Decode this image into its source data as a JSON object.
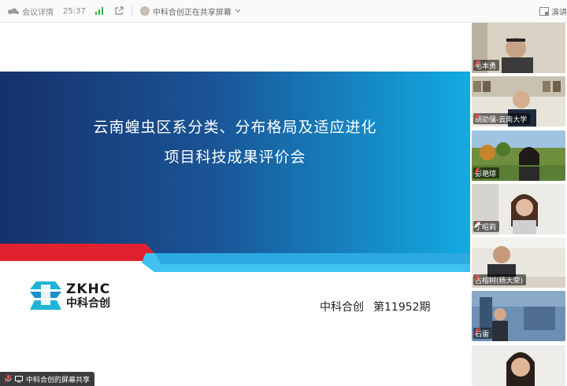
{
  "topbar": {
    "meeting_details": "会议详情",
    "elapsed": "25:37",
    "presenter_status": "中科合创正在共享屏幕",
    "right_label": "演讲"
  },
  "slide": {
    "title_line1": "云南蝗虫区系分类、分布格局及适应进化",
    "title_line2": "项目科技成果评价会",
    "logo_en": "ZKHC",
    "logo_cn": "中科合创",
    "org": "中科合创",
    "issue": "第11952期"
  },
  "share_tag": "中科合创的屏幕共享",
  "participants": [
    {
      "name": "毛本勇"
    },
    {
      "name": "胡劭骥-云南大学"
    },
    {
      "name": "彭艳琼"
    },
    {
      "name": "丁昭莉"
    },
    {
      "name": "古榕树(杨大荣)"
    },
    {
      "name": "石雷"
    },
    {
      "name": ""
    }
  ],
  "colors": {
    "banner_dark": "#16316b",
    "banner_light": "#1aa8e0",
    "accent_red": "#e0212e",
    "accent_cyan": "#3fc3ee"
  },
  "icons": [
    "meeting-logo-icon",
    "signal-icon",
    "share-out-icon",
    "chevron-down-icon",
    "mic-muted-icon",
    "screen-share-icon"
  ]
}
